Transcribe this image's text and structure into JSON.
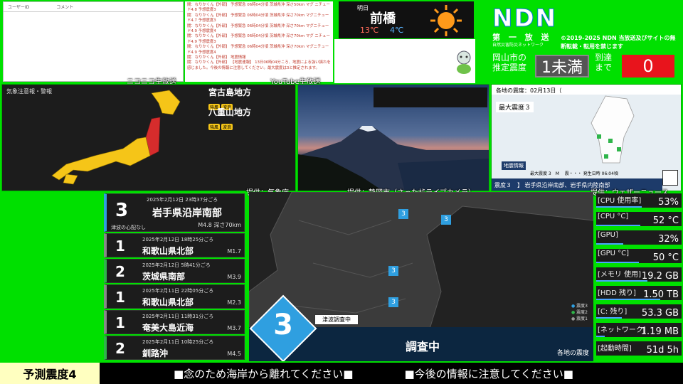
{
  "comments": {
    "col_user": "ユーザーID",
    "col_comment": "コメント"
  },
  "chat_lines": [
    "闇：なりかくん【外部】 予想緊急 06時04分頃 茨城県沖 深さ50km マグ ニチュード4.8 予想震度3",
    "闇：なりかくん【外部】 予想緊急 06時04分頃 茨城県沖 深さ70km マグニチュード4.7 予想震度3",
    "闇：なりかくん【外部】 予想緊急 06時04分頃 茨城県沖 深さ70km マグニチュード4.9 予想震度4",
    "闇：なりかくん【外部】 予想緊急 06時04分頃 茨城県沖 深さ70km マグ ニチュード4.9 予想震度3",
    "闇：なりかくん【外部】 予想緊急 06時04分頃 茨城県沖 深さ70km マグニチュー ド4.9 予想震度4",
    "闇：なりかくん【外部】 地震情報",
    "闇：なりかくん【外部】 【地震速報】 13日06時04分ころ、地震による強い揺れを感じました。今後の情報に注意してください。最大震度は3と推定されます。"
  ],
  "labels": {
    "niconico": "ニコニコ生放送",
    "youtube": "YouTube生放送",
    "jma": "提供：気象庁",
    "shizuoka": "提供：静岡市（さった峠ライブカメラ）",
    "weathernews": "提供：ウェザーニュース"
  },
  "weather": {
    "date": "明日",
    "city": "前橋",
    "high": "13℃",
    "low": "4℃",
    "icon": "sun-icon"
  },
  "ndn": {
    "logo": "NDN",
    "subtitle": "第 一 放 送",
    "subtitle2": "自然災害防災ネットワーク",
    "copyright": "©2019-2025 NDN 当放送及びサイトの無断転載・転用を禁じます",
    "city_label": "岡山市の推定震度",
    "intensity": "1未満",
    "arrival_label": "到達まで",
    "arrival": "0"
  },
  "warning_panel": {
    "title": "気象注意報・警報",
    "areas": [
      {
        "name": "宮古島地方",
        "tags": [
          "強風",
          "波浪"
        ]
      },
      {
        "name": "八重山地方",
        "tags": [
          "強風",
          "波浪"
        ]
      }
    ]
  },
  "quake_map": {
    "header": "各地の震度：02月13日（",
    "max": "最大震度３",
    "footer": "震度３　】 岩手県沿岸南部、岩手県内陸南部",
    "info": "地震情報",
    "meta": "最大震度 3　M 　震・・・ 発生日時 06:04頃"
  },
  "quakes": [
    {
      "when": "2025年2月12日 23時37分ごろ",
      "int": "3",
      "place": "岩手県沿岸南部",
      "mag": "M4.8 深さ70km",
      "note": "津波の心配なし",
      "accent": "#2f9fe0"
    },
    {
      "when": "2025年2月12日 18時25分ごろ",
      "int": "1",
      "place": "和歌山県北部",
      "mag": "M1.7",
      "accent": "#888888"
    },
    {
      "when": "2025年2月12日 5時41分ごろ",
      "int": "2",
      "place": "茨城県南部",
      "mag": "M3.9",
      "accent": "#2fb54a"
    },
    {
      "when": "2025年2月11日 22時05分ごろ",
      "int": "1",
      "place": "和歌山県北部",
      "mag": "M2.3",
      "accent": "#888888"
    },
    {
      "when": "2025年2月11日 11時31分ごろ",
      "int": "1",
      "place": "奄美大島近海",
      "mag": "M3.7",
      "accent": "#888888"
    },
    {
      "when": "2025年2月11日 10時25分ごろ",
      "int": "2",
      "place": "釧路沖",
      "mag": "M4.5",
      "accent": "#2fb54a"
    }
  ],
  "central_map": {
    "big_int": "3",
    "tsunami": "津波調査中",
    "status": "調査中",
    "corner": "各地の震度",
    "legend": [
      "震度3",
      "震度2",
      "震度1"
    ],
    "markers": [
      "3",
      "3",
      "3",
      "3"
    ]
  },
  "stats": [
    {
      "k": "[CPU 使用率]",
      "v": "53%",
      "fill": 0.53
    },
    {
      "k": "[CPU °C]",
      "v": "52 °C",
      "fill": 0.52
    },
    {
      "k": "[GPU]",
      "v": "32%",
      "fill": 0.32
    },
    {
      "k": "[GPU °C]",
      "v": "50 °C",
      "fill": 0.5
    },
    {
      "k": "[メモリ 使用]",
      "v": "19.2 GB",
      "fill": 0.6
    },
    {
      "k": "[HDD 残り]",
      "v": "1.50 TB",
      "fill": 0.75
    },
    {
      "k": "[C: 残り]",
      "v": "53.3 GB",
      "fill": 0.3
    },
    {
      "k": "[ネットワーク]",
      "v": "1.19 MB",
      "fill": 0.1
    },
    {
      "k": "[起動時間]",
      "v": "51d 5h",
      "fill": 0
    }
  ],
  "footer": {
    "predicted": "予測震度4",
    "msg1": "■念のため海岸から離れてください■",
    "msg2": "■今後の情報に注意してください■"
  }
}
